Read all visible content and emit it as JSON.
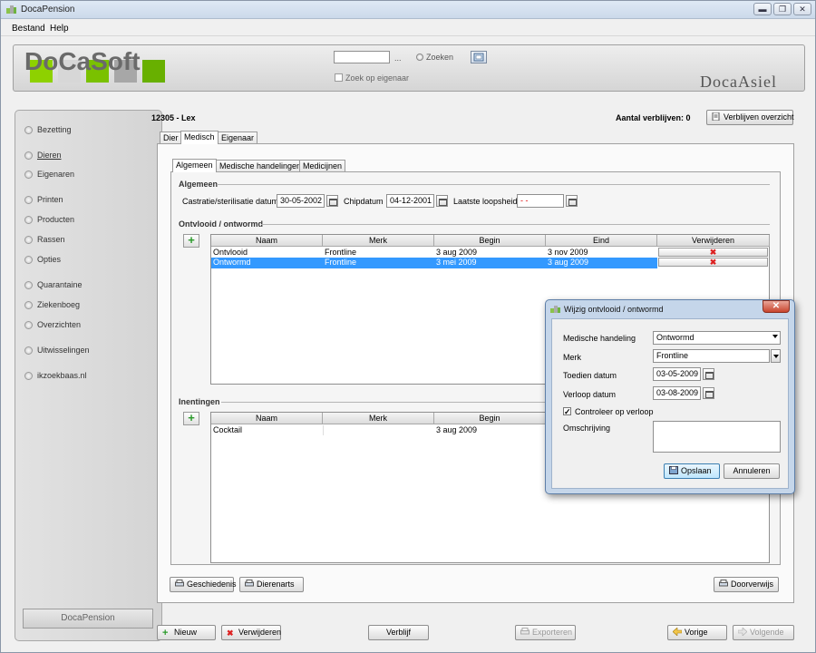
{
  "window": {
    "title": "DocaPension",
    "minimize": "▬",
    "maximize": "❐",
    "close": "✕"
  },
  "menu": {
    "file": "Bestand",
    "help": "Help"
  },
  "header": {
    "logo": "DoCaSoft",
    "search_value": "",
    "dots": "...",
    "search_label": "Zoeken",
    "owner_search": "Zoek op eigenaar",
    "app_name": "DocaAsiel"
  },
  "sidebar": {
    "items": [
      "Bezetting",
      "Dieren",
      "Eigenaren",
      "Printen",
      "Producten",
      "Rassen",
      "Opties",
      "Quarantaine",
      "Ziekenboeg",
      "Overzichten",
      "Uitwisselingen",
      "ikzoekbaas.nl"
    ],
    "footer": "DocaPension"
  },
  "main": {
    "title": "12305 - Lex",
    "stays": "Aantal verblijven: 0",
    "stays_overview": "Verblijven overzicht",
    "tabs": [
      "Dier",
      "Medisch",
      "Eigenaar"
    ],
    "subtabs": [
      "Algemeen",
      "Medische handelingen",
      "Medicijnen"
    ],
    "algemeen": {
      "section": "Algemeen",
      "castratie_label": "Castratie/sterilisatie datum",
      "castratie_value": "30-05-2002",
      "chip_label": "Chipdatum",
      "chip_value": "04-12-2001",
      "loops_label": "Laatste loopsheid",
      "loops_value": "- -"
    },
    "ontvlooid": {
      "section": "Ontvlooid / ontwormd",
      "headers": [
        "Naam",
        "Merk",
        "Begin",
        "Eind",
        "Verwijderen"
      ],
      "rows": [
        [
          "Ontvlooid",
          "Frontline",
          "3 aug 2009",
          "3 nov 2009"
        ],
        [
          "Ontwormd",
          "Frontline",
          "3 mei 2009",
          "3 aug 2009"
        ]
      ],
      "delete_glyph": "✖"
    },
    "inentingen": {
      "section": "Inentingen",
      "headers": [
        "Naam",
        "Merk",
        "Begin"
      ],
      "rows": [
        [
          "Cocktail",
          "",
          "3 aug 2009"
        ]
      ]
    },
    "buttons": {
      "history": "Geschiedenis",
      "vet": "Dierenarts",
      "referral": "Doorverwijs"
    }
  },
  "bottom": {
    "new": "Nieuw",
    "delete": "Verwijderen",
    "stay": "Verblijf",
    "export": "Exporteren",
    "prev": "Vorige",
    "next": "Volgende"
  },
  "dialog": {
    "title": "Wijzig ontvlooid / ontwormd",
    "close": "✕",
    "medische_label": "Medische handeling",
    "medische_value": "Ontwormd",
    "merk_label": "Merk",
    "merk_value": "Frontline",
    "toedien_label": "Toedien datum",
    "toedien_value": "03-05-2009",
    "verloop_label": "Verloop datum",
    "verloop_value": "03-08-2009",
    "controleer_label": "Controleer op verloop",
    "controleer_checked": "✓",
    "omschrijving_label": "Omschrijving",
    "omschrijving_value": "",
    "save": "Opslaan",
    "cancel": "Annuleren"
  }
}
